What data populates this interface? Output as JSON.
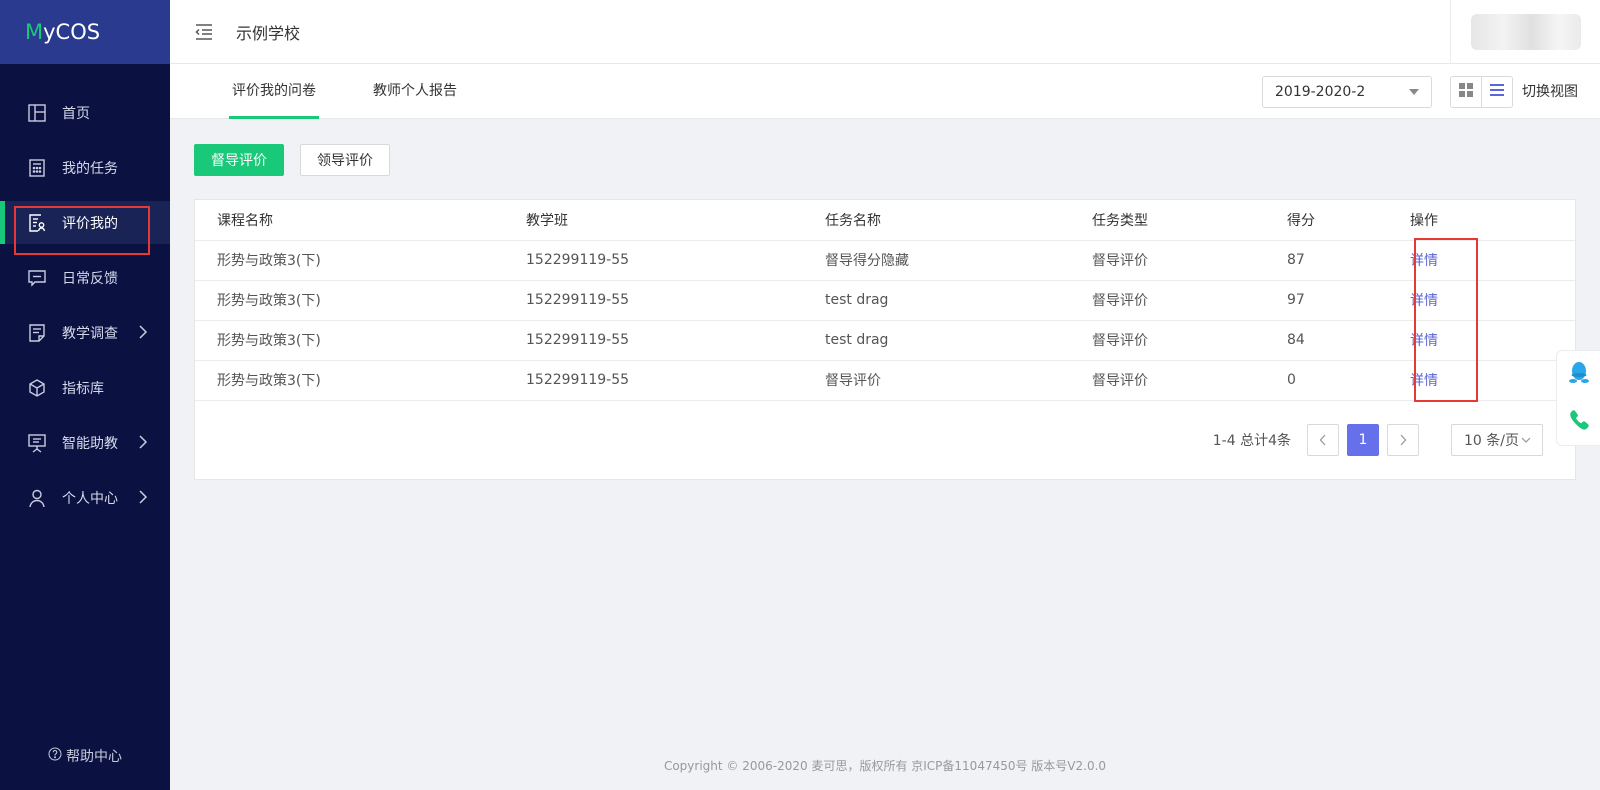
{
  "app": {
    "logo_m": "M",
    "logo_rest": "yCOS",
    "school_name": "示例学校"
  },
  "sidebar": {
    "items": [
      {
        "label": "首页",
        "icon": "layout-icon",
        "active": false,
        "has_children": false
      },
      {
        "label": "我的任务",
        "icon": "calculator-icon",
        "active": false,
        "has_children": false
      },
      {
        "label": "评价我的",
        "icon": "evaluation-icon",
        "active": true,
        "has_children": false
      },
      {
        "label": "日常反馈",
        "icon": "feedback-icon",
        "active": false,
        "has_children": false
      },
      {
        "label": "教学调查",
        "icon": "survey-icon",
        "active": false,
        "has_children": true
      },
      {
        "label": "指标库",
        "icon": "cube-icon",
        "active": false,
        "has_children": false
      },
      {
        "label": "智能助教",
        "icon": "presentation-icon",
        "active": false,
        "has_children": true
      },
      {
        "label": "个人中心",
        "icon": "user-icon",
        "active": false,
        "has_children": true
      }
    ],
    "help_label": "帮助中心"
  },
  "tabs": [
    {
      "label": "评价我的问卷",
      "active": true
    },
    {
      "label": "教师个人报告",
      "active": false
    }
  ],
  "term_select": {
    "value": "2019-2020-2"
  },
  "view_switch_label": "切换视图",
  "filters": {
    "primary": "督导评价",
    "secondary": "领导评价"
  },
  "table": {
    "columns": [
      "课程名称",
      "教学班",
      "任务名称",
      "任务类型",
      "得分",
      "操作"
    ],
    "rows": [
      {
        "course": "形势与政策3(下)",
        "class": "152299119-55",
        "task": "督导得分隐藏",
        "type": "督导评价",
        "score": "87",
        "action": "详情"
      },
      {
        "course": "形势与政策3(下)",
        "class": "152299119-55",
        "task": "test drag",
        "type": "督导评价",
        "score": "97",
        "action": "详情"
      },
      {
        "course": "形势与政策3(下)",
        "class": "152299119-55",
        "task": "test drag",
        "type": "督导评价",
        "score": "84",
        "action": "详情"
      },
      {
        "course": "形势与政策3(下)",
        "class": "152299119-55",
        "task": "督导评价",
        "type": "督导评价",
        "score": "0",
        "action": "详情"
      }
    ]
  },
  "pagination": {
    "summary": "1-4 总计4条",
    "current_page": "1",
    "page_size": "10 条/页"
  },
  "footer": "Copyright © 2006-2020 麦可思，版权所有 京ICP备11047450号 版本号V2.0.0",
  "colors": {
    "sidebar_bg": "#0b1241",
    "logo_bg": "#2a3a8f",
    "accent_green": "#19c878",
    "link_blue": "#5b66d8",
    "page_active": "#6570ea",
    "highlight_red": "#e53935"
  }
}
